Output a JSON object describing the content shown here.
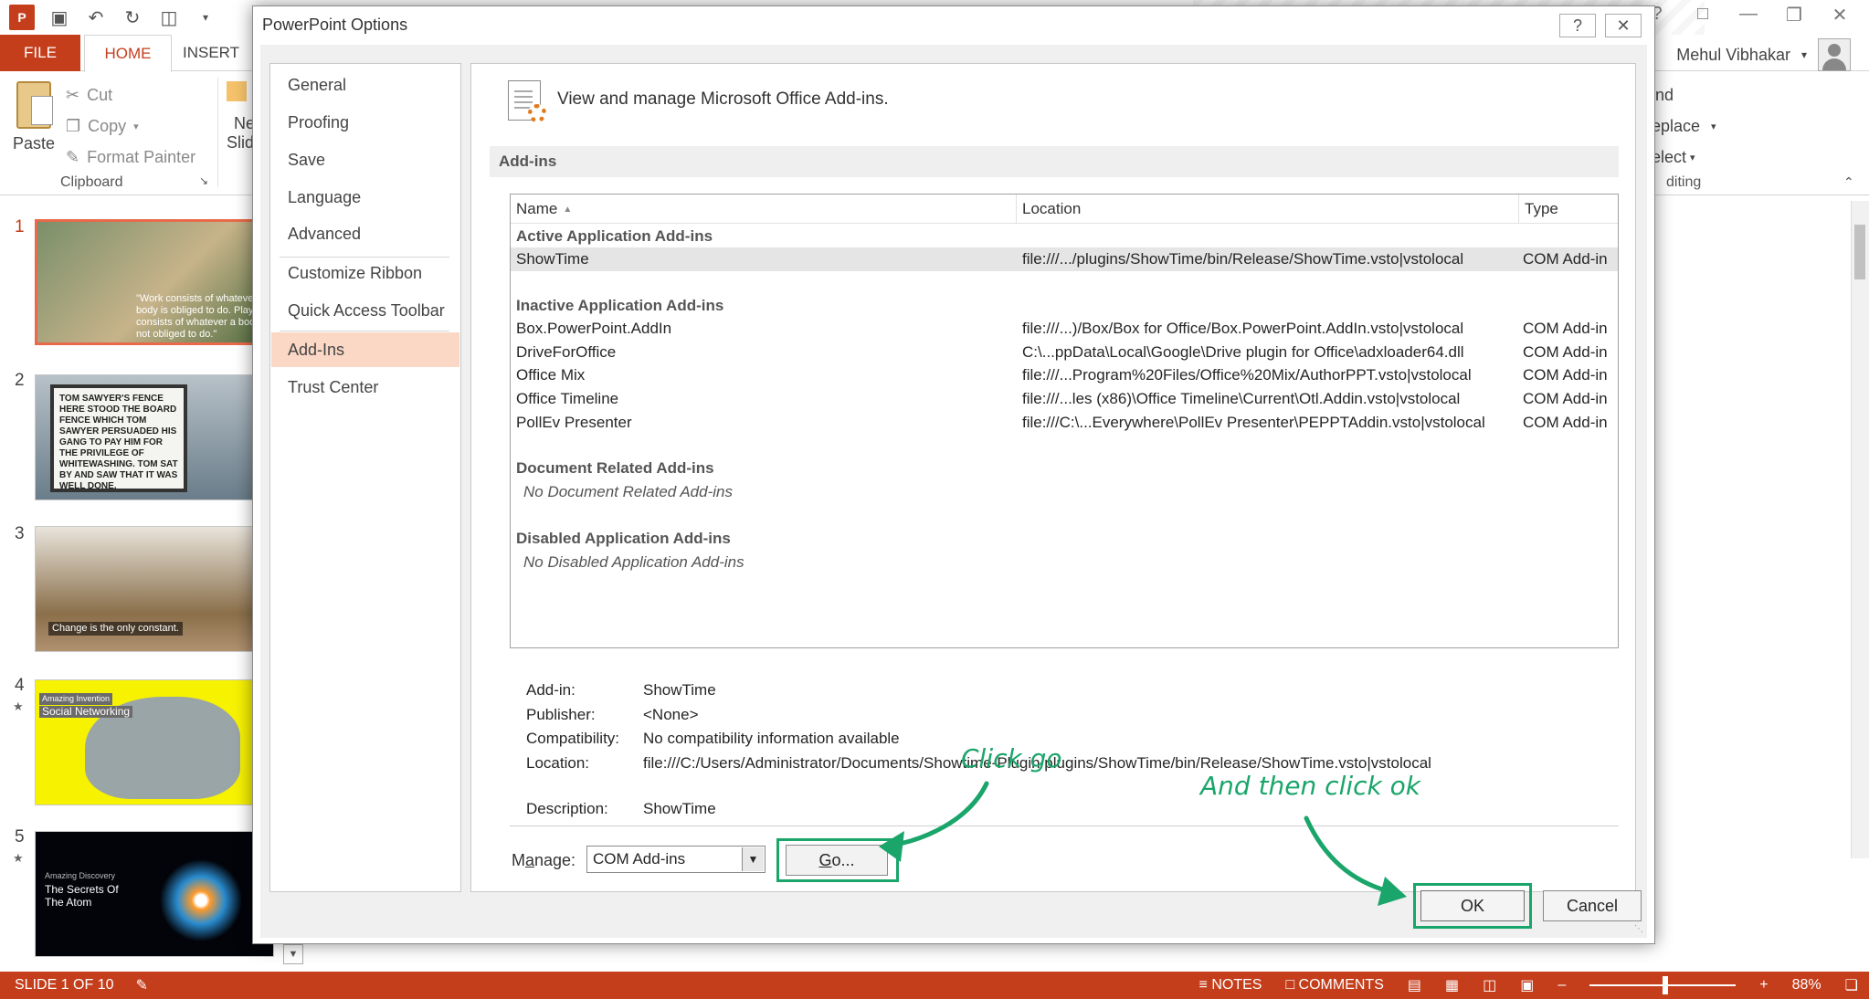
{
  "app": {
    "file_tab": "FILE",
    "home_tab": "HOME",
    "insert_tab": "INSERT",
    "user_name": "Mehul Vibhakar"
  },
  "ribbon": {
    "paste": "Paste",
    "cut": "Cut",
    "copy": "Copy",
    "format_painter": "Format Painter",
    "clipboard_group": "Clipboard",
    "new_slide_partial": "Ne",
    "new_slide_partial2": "Slid",
    "find_partial": "ind",
    "replace_partial": "eplace",
    "select_partial": "elect",
    "editing_partial": "diting"
  },
  "thumbnails": [
    {
      "num": "1",
      "text": "\"Work consists of whatever a body is obliged to do. Play consists of whatever a body is not obliged to do.\""
    },
    {
      "num": "2",
      "text": "TOM SAWYER'S FENCE HERE STOOD THE BOARD FENCE WHICH TOM SAWYER PERSUADED HIS GANG TO PAY HIM FOR THE PRIVILEGE OF WHITEWASHING. TOM SAT BY AND SAW THAT IT WAS WELL DONE."
    },
    {
      "num": "3",
      "text": "Change is the only constant."
    },
    {
      "num": "4",
      "text": "Amazing Invention",
      "text2": "Social Networking"
    },
    {
      "num": "5",
      "text": "Amazing Discovery",
      "text2": "The Secrets Of The Atom"
    }
  ],
  "dialog": {
    "title": "PowerPoint Options",
    "help": "?",
    "close": "✕",
    "nav": [
      {
        "label": "General"
      },
      {
        "label": "Proofing"
      },
      {
        "label": "Save"
      },
      {
        "label": "Language"
      },
      {
        "label": "Advanced"
      },
      {
        "label": "Customize Ribbon"
      },
      {
        "label": "Quick Access Toolbar"
      },
      {
        "label": "Add-Ins"
      },
      {
        "label": "Trust Center"
      }
    ],
    "header_text": "View and manage Microsoft Office Add-ins.",
    "section_title": "Add-ins",
    "columns": {
      "name": "Name",
      "location": "Location",
      "type": "Type"
    },
    "active_category": "Active Application Add-ins",
    "active_rows": [
      {
        "name": "ShowTime",
        "location": "file:///.../plugins/ShowTime/bin/Release/ShowTime.vsto|vstolocal",
        "type": "COM Add-in"
      }
    ],
    "inactive_category": "Inactive Application Add-ins",
    "inactive_rows": [
      {
        "name": "Box.PowerPoint.AddIn",
        "location": "file:///...)/Box/Box for Office/Box.PowerPoint.AddIn.vsto|vstolocal",
        "type": "COM Add-in"
      },
      {
        "name": "DriveForOffice",
        "location": "C:\\...ppData\\Local\\Google\\Drive plugin for Office\\adxloader64.dll",
        "type": "COM Add-in"
      },
      {
        "name": "Office Mix",
        "location": "file:///...Program%20Files/Office%20Mix/AuthorPPT.vsto|vstolocal",
        "type": "COM Add-in"
      },
      {
        "name": "Office Timeline",
        "location": "file:///...les (x86)\\Office Timeline\\Current\\Otl.Addin.vsto|vstolocal",
        "type": "COM Add-in"
      },
      {
        "name": "PollEv Presenter",
        "location": "file:///C:\\...Everywhere\\PollEv Presenter\\PEPPTAddin.vsto|vstolocal",
        "type": "COM Add-in"
      }
    ],
    "document_category": "Document Related Add-ins",
    "document_empty": "No Document Related Add-ins",
    "disabled_category": "Disabled Application Add-ins",
    "disabled_empty": "No Disabled Application Add-ins",
    "details": {
      "addin_label": "Add-in:",
      "addin_value": "ShowTime",
      "publisher_label": "Publisher:",
      "publisher_value": "<None>",
      "compat_label": "Compatibility:",
      "compat_value": "No compatibility information available",
      "location_label": "Location:",
      "location_value": "file:///C:/Users/Administrator/Documents/Showtime-Plugin/plugins/ShowTime/bin/Release/ShowTime.vsto|vstolocal",
      "description_label": "Description:",
      "description_value": "ShowTime"
    },
    "manage_label_pre": "M",
    "manage_label_u": "a",
    "manage_label_post": "nage:",
    "manage_value": "COM Add-ins",
    "go_u": "G",
    "go_rest": "o...",
    "ok": "OK",
    "cancel": "Cancel"
  },
  "annotations": {
    "click_go": "Click go",
    "click_ok": "And then click ok",
    "color": "#1aa56a"
  },
  "status": {
    "slide": "SLIDE 1 OF 10",
    "notes": "NOTES",
    "comments": "COMMENTS",
    "zoom": "88%"
  },
  "colors": {
    "accent": "#c43e1c",
    "nav_selected": "#fbd7c6",
    "highlight": "#1aa56a"
  }
}
